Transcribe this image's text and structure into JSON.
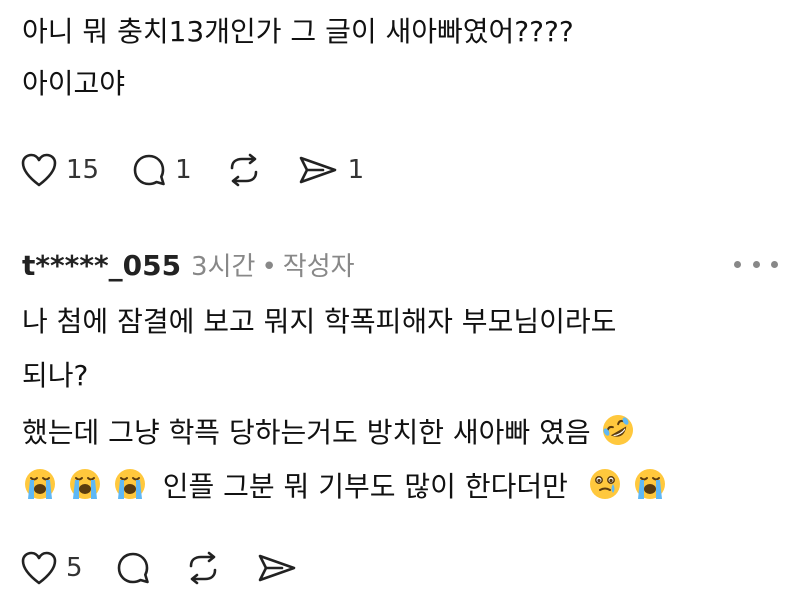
{
  "post": {
    "lines": [
      "아니 뭐 충치13개인가 그 글이 새아빠였어????",
      "아이고야"
    ],
    "like_count": "15",
    "comment_count": "1",
    "share_count": "1"
  },
  "reply": {
    "username": "t*****_055",
    "time": "3시간",
    "separator": "•",
    "role": "작성자",
    "lines": [
      "나 첨에 잠결에 보고 뭐지 학폭피해자 부모님이라도",
      "되나?",
      "했는데 그냥 학픅 당하는거도 방치한 새아빠 였음",
      "인플 그분 뭐 기부도 많이 한다더만"
    ],
    "like_count": "5"
  },
  "icons": {
    "like": "heart-icon",
    "comment": "comment-bubble-icon",
    "repost": "repost-icon",
    "share": "send-icon",
    "more": "more-horizontal-icon",
    "rofl": "rolling-laughing-emoji",
    "crying": "loudly-crying-emoji",
    "tear": "face-holding-back-tears-emoji"
  },
  "colors": {
    "text": "#111111",
    "muted": "#888888",
    "emoji_yellow": "#FFC83D",
    "tear_blue": "#5FB8F5"
  }
}
